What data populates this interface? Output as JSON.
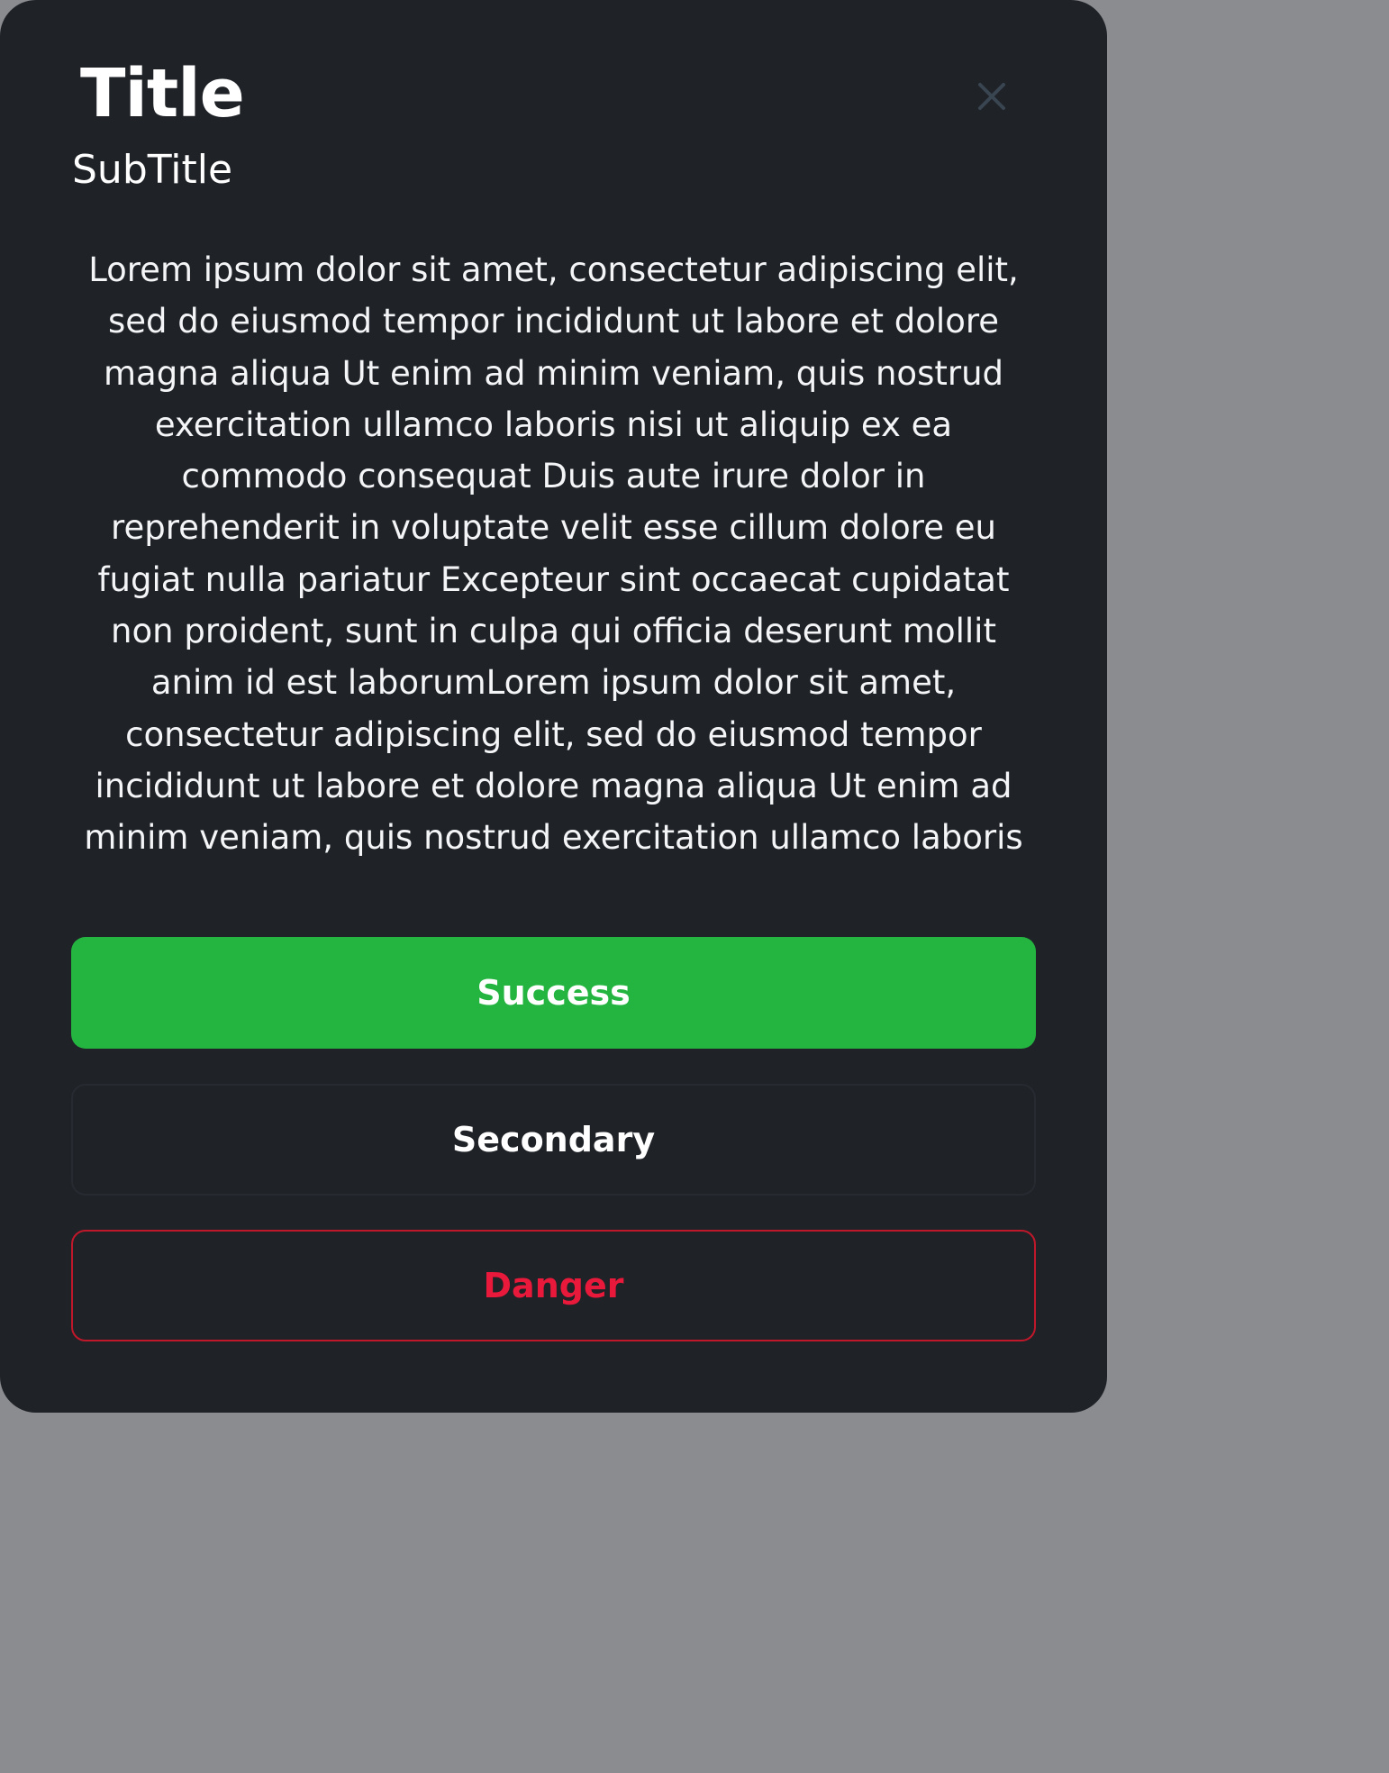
{
  "modal": {
    "title": "Title",
    "subtitle": "SubTitle",
    "close_icon": "close-icon",
    "body": "Lorem ipsum dolor sit amet, consectetur adipiscing elit, sed do eiusmod tempor incididunt ut labore et dolore magna aliqua Ut enim ad minim veniam, quis nostrud exercitation ullamco laboris nisi ut aliquip ex ea commodo consequat Duis aute irure dolor in reprehenderit in voluptate velit esse cillum dolore eu fugiat nulla pariatur Excepteur sint occaecat cupidatat non proident, sunt in culpa qui officia deserunt mollit anim id est laborumLorem ipsum dolor sit amet, consectetur adipiscing elit, sed do eiusmod tempor incididunt ut labore et dolore magna aliqua Ut enim ad minim veniam, quis nostrud exercitation ullamco laboris",
    "buttons": {
      "success_label": "Success",
      "secondary_label": "Secondary",
      "danger_label": "Danger"
    }
  },
  "colors": {
    "background": "#1f2227",
    "success": "#24b541",
    "danger": "#e8193a",
    "close_icon": "#3a4552"
  }
}
